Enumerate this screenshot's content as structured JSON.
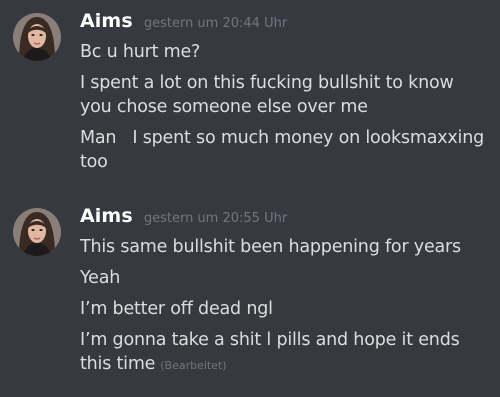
{
  "groups": [
    {
      "author": "Aims",
      "timestamp": "gestern um 20:44 Uhr",
      "messages": [
        {
          "text": "Bc u hurt me?"
        },
        {
          "text": "I spent a lot on this fucking bullshit to know you chose someone else over me"
        },
        {
          "text": "Man   I spent so much money on looksmaxxing too"
        }
      ]
    },
    {
      "author": "Aims",
      "timestamp": "gestern um 20:55 Uhr",
      "messages": [
        {
          "text": "This same bullshit been happening for years"
        },
        {
          "text": "Yeah"
        },
        {
          "text": "I’m better off dead ngl"
        },
        {
          "text": "I’m gonna take a shit l pills and hope it ends this time",
          "edited": "(Bearbeitet)"
        }
      ]
    }
  ],
  "colors": {
    "background": "#36393f",
    "username": "#ffffff",
    "message_text": "#dcddde",
    "muted": "#72767d"
  }
}
